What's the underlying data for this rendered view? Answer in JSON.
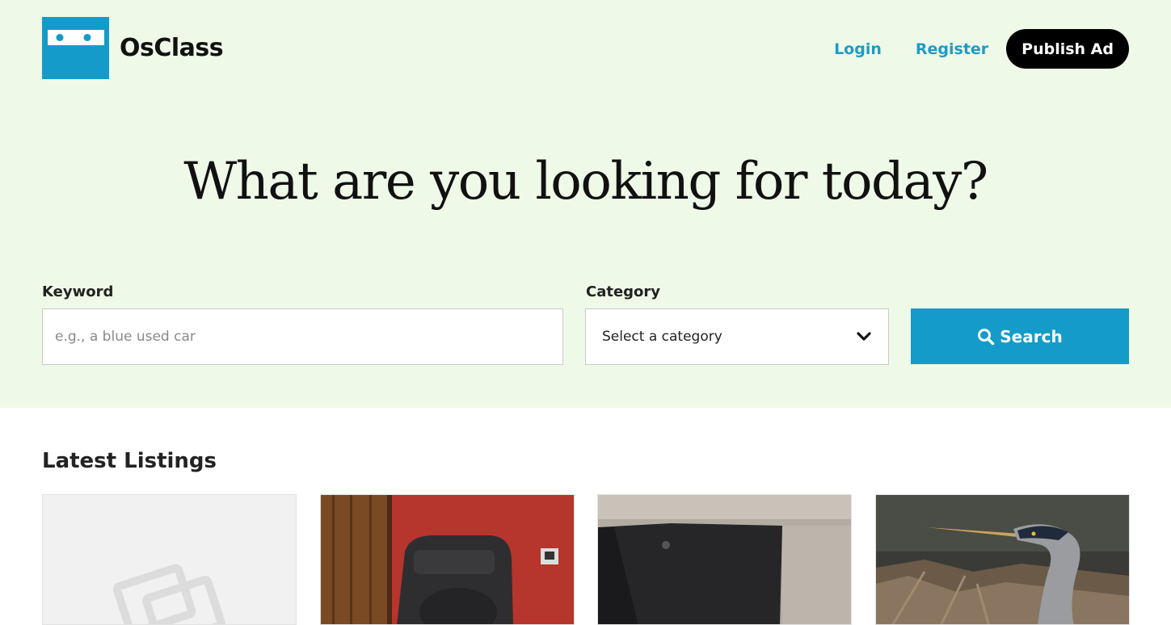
{
  "brand": {
    "name": "OsClass",
    "logo_icon": "logo-icon"
  },
  "nav": {
    "login": "Login",
    "register": "Register",
    "publish": "Publish Ad"
  },
  "hero": {
    "headline": "What are you looking for today?"
  },
  "search": {
    "keyword_label": "Keyword",
    "keyword_placeholder": "e.g., a blue used car",
    "category_label": "Category",
    "category_selected": "Select a category",
    "button_label": "Search",
    "button_icon": "search-icon"
  },
  "listings": {
    "title": "Latest Listings"
  },
  "colors": {
    "hero_bg": "#eef9e8",
    "accent": "#149bc9",
    "link": "#1e9bc6",
    "publish_bg": "#000000"
  }
}
